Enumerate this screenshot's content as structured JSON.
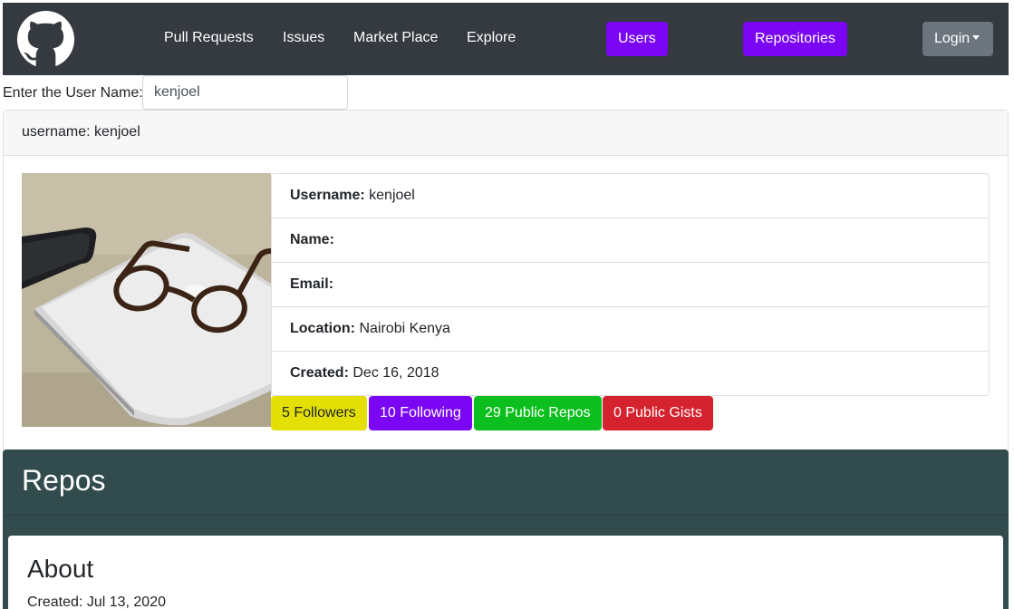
{
  "navbar": {
    "links": [
      "Pull Requests",
      "Issues",
      "Market Place",
      "Explore"
    ],
    "users_button": "Users",
    "repositories_button": "Repositories",
    "login_button": "Login",
    "colors": {
      "background": "#343a40",
      "accent": "#7a06f3",
      "login": "#6c757d"
    }
  },
  "search": {
    "label": "Enter the User Name:",
    "value": "kenjoel"
  },
  "profile": {
    "header": "username: kenjoel",
    "fields": [
      {
        "label": "Username:",
        "value": "kenjoel"
      },
      {
        "label": "Name:",
        "value": ""
      },
      {
        "label": "Email:",
        "value": ""
      },
      {
        "label": "Location:",
        "value": "Nairobi Kenya"
      },
      {
        "label": "Created:",
        "value": "Dec 16, 2018"
      }
    ],
    "stats": {
      "followers": "5 Followers",
      "following": "10 Following",
      "public_repos": "29 Public Repos",
      "public_gists": "0 Public Gists"
    }
  },
  "repos": {
    "title": "Repos",
    "first_card": {
      "title": "About",
      "created": "Created: Jul 13, 2020"
    }
  }
}
